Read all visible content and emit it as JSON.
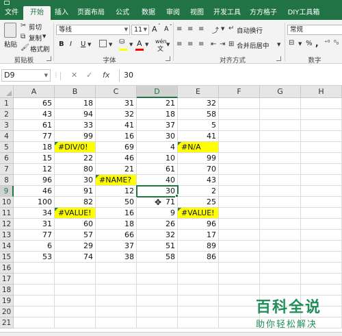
{
  "ribbon_tabs": [
    "文件",
    "开始",
    "插入",
    "页面布局",
    "公式",
    "数据",
    "审阅",
    "视图",
    "开发工具",
    "方方格子",
    "DIY工具箱"
  ],
  "active_tab": "开始",
  "clipboard": {
    "paste_label": "粘贴",
    "cut_label": "剪切",
    "copy_label": "复制",
    "format_painter_label": "格式刷",
    "group_label": "剪贴板"
  },
  "font": {
    "name": "等线",
    "size": "11",
    "grow_label": "A",
    "shrink_label": "A",
    "bold_label": "B",
    "italic_label": "I",
    "underline_label": "U",
    "group_label": "字体",
    "wen_label": "wén",
    "font_color": "#ff0000",
    "fill_color": "#ffff00"
  },
  "alignment": {
    "wrap_label": "自动换行",
    "merge_label": "合并后居中",
    "group_label": "对齐方式"
  },
  "number": {
    "format": "常规",
    "percent_label": "%",
    "comma_label": ",",
    "group_label": "数字"
  },
  "formula_bar": {
    "name_box": "D9",
    "cancel_label": "✕",
    "enter_label": "✓",
    "fx_label": "fx",
    "formula": "30"
  },
  "columns": [
    "A",
    "B",
    "C",
    "D",
    "E",
    "F",
    "G",
    "H"
  ],
  "selected_column": "D",
  "selected_row": 9,
  "rows": [
    {
      "n": "1",
      "cells": [
        "65",
        "18",
        "31",
        "21",
        "32"
      ]
    },
    {
      "n": "2",
      "cells": [
        "43",
        "94",
        "32",
        "18",
        "58"
      ]
    },
    {
      "n": "3",
      "cells": [
        "61",
        "33",
        "41",
        "37",
        "5"
      ]
    },
    {
      "n": "4",
      "cells": [
        "77",
        "99",
        "16",
        "30",
        "41"
      ]
    },
    {
      "n": "5",
      "cells": [
        "18",
        "#DIV/0!",
        "69",
        "4",
        "#N/A"
      ]
    },
    {
      "n": "6",
      "cells": [
        "15",
        "22",
        "46",
        "10",
        "99"
      ]
    },
    {
      "n": "7",
      "cells": [
        "12",
        "80",
        "21",
        "61",
        "70"
      ]
    },
    {
      "n": "8",
      "cells": [
        "96",
        "30",
        "#NAME?",
        "40",
        "43"
      ]
    },
    {
      "n": "9",
      "cells": [
        "46",
        "91",
        "12",
        "30",
        "2"
      ]
    },
    {
      "n": "10",
      "cells": [
        "100",
        "82",
        "50",
        "71",
        "25"
      ]
    },
    {
      "n": "11",
      "cells": [
        "34",
        "#VALUE!",
        "16",
        "9",
        "#VALUE!"
      ]
    },
    {
      "n": "12",
      "cells": [
        "31",
        "60",
        "18",
        "26",
        "96"
      ]
    },
    {
      "n": "13",
      "cells": [
        "77",
        "57",
        "66",
        "32",
        "17"
      ]
    },
    {
      "n": "14",
      "cells": [
        "6",
        "29",
        "37",
        "51",
        "89"
      ]
    },
    {
      "n": "15",
      "cells": [
        "53",
        "74",
        "38",
        "58",
        "86"
      ]
    },
    {
      "n": "16",
      "cells": [
        "",
        "",
        "",
        "",
        ""
      ]
    },
    {
      "n": "17",
      "cells": [
        "",
        "",
        "",
        "",
        ""
      ]
    },
    {
      "n": "18",
      "cells": [
        "",
        "",
        "",
        "",
        ""
      ]
    },
    {
      "n": "19",
      "cells": [
        "",
        "",
        "",
        "",
        ""
      ]
    },
    {
      "n": "20",
      "cells": [
        "",
        "",
        "",
        "",
        ""
      ]
    },
    {
      "n": "21",
      "cells": [
        "",
        "",
        "",
        "",
        ""
      ]
    }
  ],
  "colors": {
    "accent": "#217346",
    "error_fill": "#ffff00",
    "watermark": "#1e8f5a"
  },
  "watermark": {
    "title": "百科全说",
    "subtitle": "助你轻松解决"
  }
}
